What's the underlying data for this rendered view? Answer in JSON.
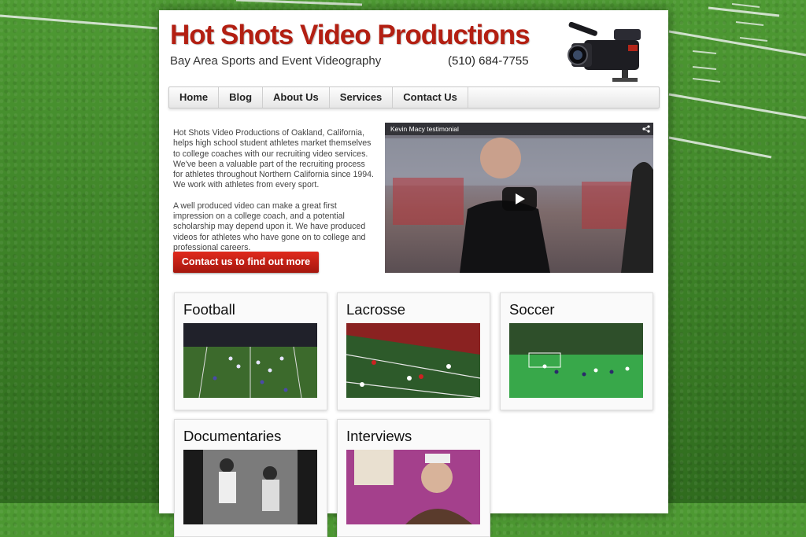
{
  "header": {
    "title": "Hot Shots Video Productions",
    "tagline": "Bay Area Sports and Event Videography",
    "phone": "(510) 684-7755"
  },
  "nav": {
    "items": [
      {
        "label": "Home"
      },
      {
        "label": "Blog"
      },
      {
        "label": "About Us"
      },
      {
        "label": "Services"
      },
      {
        "label": "Contact Us"
      }
    ]
  },
  "intro": {
    "paragraph1": "Hot Shots Video Productions of Oakland, California, helps high school student athletes market themselves to college coaches with our recruiting video services. We've been a valuable part of the recruiting process for athletes throughout Northern California since 1994. We work with athletes from every sport.",
    "paragraph2": "A well produced video can make a great first impression on a college coach, and a potential scholarship may depend upon it. We have produced videos for athletes who have gone on to college and professional careers.",
    "cta_label": "Contact us to find out more"
  },
  "video": {
    "title": "Kevin Macy testimonial"
  },
  "categories": [
    {
      "title": "Football"
    },
    {
      "title": "Lacrosse"
    },
    {
      "title": "Soccer"
    },
    {
      "title": "Documentaries"
    },
    {
      "title": "Interviews"
    }
  ],
  "colors": {
    "brand_red": "#b31f12",
    "field_green": "#3f8a2a"
  }
}
